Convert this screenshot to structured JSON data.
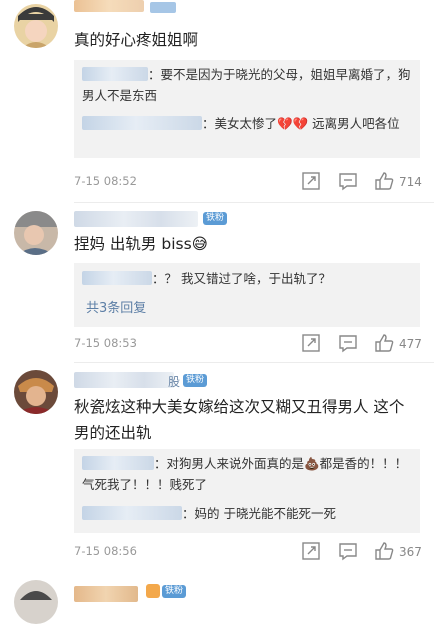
{
  "comments": [
    {
      "text": "真的好心疼姐姐啊",
      "replies": [
        {
          "text": "：要不是因为于晓光的父母，姐姐早离婚了，狗男人不是东西"
        },
        {
          "text": "：美女太惨了💔💔 远离男人吧各位"
        }
      ],
      "time": "7-15 08:52",
      "likes": "714"
    },
    {
      "badge": "铁粉",
      "text": "捏妈 出轨男 biss😅",
      "replies": [
        {
          "text": "：？ 我又错过了啥，于出轨了？"
        }
      ],
      "more_replies": "共3条回复",
      "time": "7-15 08:53",
      "likes": "477"
    },
    {
      "badge": "铁粉",
      "name_partial": "股",
      "text": "秋瓷炫这种大美女嫁给这次又糊又丑得男人 这个男的还出轨",
      "replies": [
        {
          "text": "：对狗男人来说外面真的是💩都是香的！！！气死我了！！！贱死了"
        },
        {
          "text": "：妈的 于晓光能不能死一死"
        }
      ],
      "time": "7-15 08:56",
      "likes": "367"
    },
    {
      "badge": "铁粉"
    }
  ],
  "colors": {
    "badge": "#5b9bd5",
    "link": "#5d7fa6"
  }
}
